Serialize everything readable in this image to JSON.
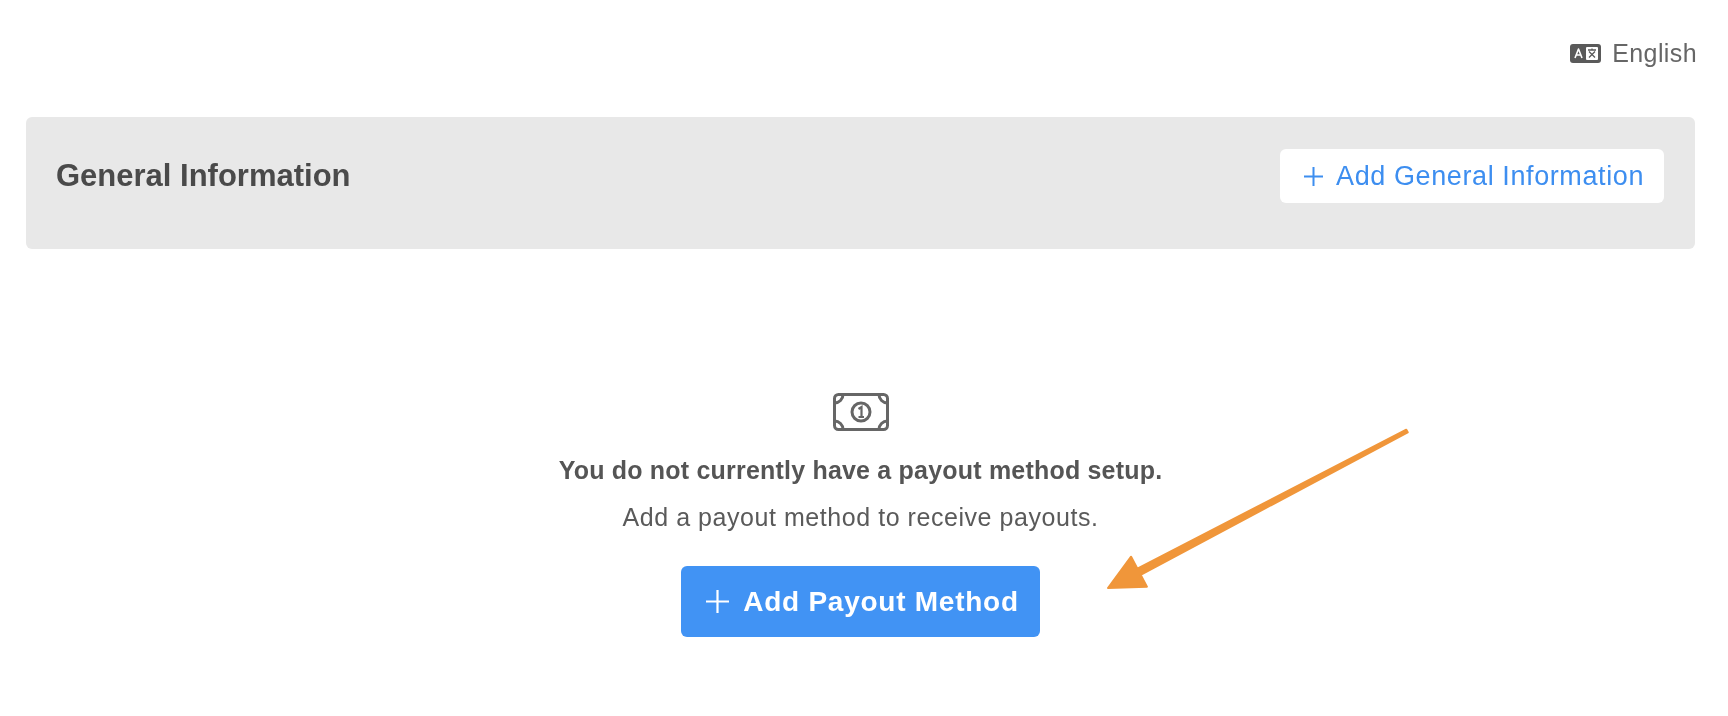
{
  "language": {
    "label": "English"
  },
  "general_information": {
    "title": "General Information",
    "add_button": "Add General Information"
  },
  "payout_methods": {
    "empty_title": "You do not currently have a payout method setup.",
    "empty_message": "Add a payout method to receive payouts.",
    "add_button": "Add Payout Method"
  }
}
